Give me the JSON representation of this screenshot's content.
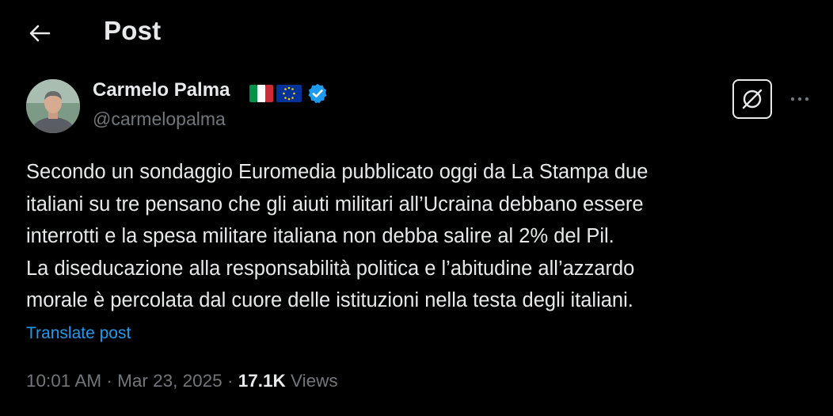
{
  "header": {
    "title": "Post",
    "back_icon": "arrow-left-icon"
  },
  "author": {
    "name": "Carmelo Palma",
    "handle": "@carmelopalma",
    "flags": [
      "italy-flag",
      "eu-flag"
    ],
    "verified_icon": "verified-badge-icon",
    "verified_color": "#1d9bf0"
  },
  "actions": {
    "grok_icon": "grok-icon",
    "more_icon": "more-horizontal-icon"
  },
  "post": {
    "text": "Secondo un sondaggio Euromedia pubblicato oggi da La Stampa due\nitaliani su tre pensano che gli aiuti militari all’Ucraina debbano essere\ninterrotti e la spesa militare italiana non debba salire al 2% del Pil.\nLa diseducazione alla responsabilità politica e l’abitudine all’azzardo\nmorale è percolata dal cuore delle istituzioni nella testa degli italiani.",
    "translate_label": "Translate post"
  },
  "meta": {
    "time": "10:01 AM",
    "separator": "·",
    "date": "Mar 23, 2025",
    "views_count": "17.1K",
    "views_label": "Views"
  },
  "colors": {
    "background": "#000000",
    "text_primary": "#e7e9ea",
    "text_secondary": "#71767b",
    "accent": "#1d9bf0"
  }
}
